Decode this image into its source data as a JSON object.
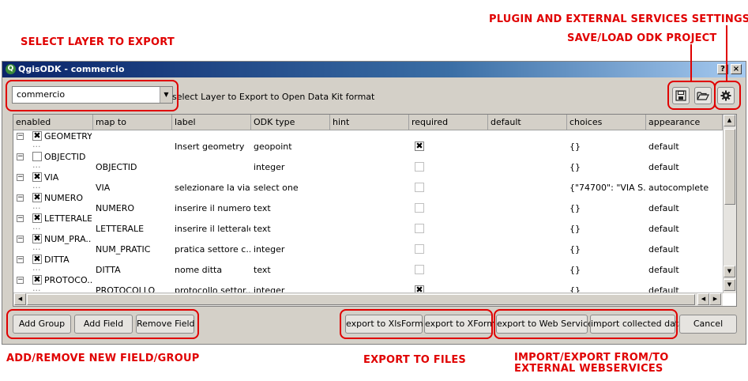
{
  "annotations": {
    "plugin_settings": "PLUGIN AND EXTERNAL SERVICES SETTINGS",
    "select_layer": "SELECT LAYER TO EXPORT",
    "save_load": "SAVE/LOAD ODK PROJECT",
    "add_remove": "ADD/REMOVE NEW FIELD/GROUP",
    "export_files": "EXPORT TO FILES",
    "import_export_line1": "IMPORT/EXPORT FROM/TO",
    "import_export_line2": "EXTERNAL WEBSERVICES"
  },
  "window": {
    "title": "QgisODK - commercio",
    "app_icon": "Q",
    "help_label": "?",
    "close_label": "×"
  },
  "layer": {
    "selected": "commercio",
    "hint": "select Layer to Export to Open Data Kit format"
  },
  "icons": {
    "save": "save-icon",
    "open": "folder-open-icon",
    "settings": "gear-icon"
  },
  "table": {
    "columns": [
      "enabled",
      "map to",
      "label",
      "ODK type",
      "hint",
      "required",
      "default",
      "choices",
      "appearance"
    ],
    "rows": [
      {
        "kind": "group",
        "enabled": true,
        "name": "GEOMETRY"
      },
      {
        "kind": "field",
        "map_to": "",
        "label": "Insert geometry",
        "odk_type": "geopoint",
        "hint": "",
        "required": true,
        "required_disabled": false,
        "default": "",
        "choices": "{}",
        "appearance": "default"
      },
      {
        "kind": "group",
        "enabled": false,
        "name": "OBJECTID"
      },
      {
        "kind": "field",
        "map_to": "OBJECTID",
        "label": "",
        "odk_type": "integer",
        "hint": "",
        "required": false,
        "required_disabled": true,
        "default": "",
        "choices": "{}",
        "appearance": "default"
      },
      {
        "kind": "group",
        "enabled": true,
        "name": "VIA"
      },
      {
        "kind": "field",
        "map_to": "VIA",
        "label": "selezionare la via",
        "odk_type": "select one",
        "hint": "",
        "required": false,
        "required_disabled": true,
        "default": "",
        "choices": "{\"74700\": \"VIA S...",
        "appearance": "autocomplete"
      },
      {
        "kind": "group",
        "enabled": true,
        "name": "NUMERO"
      },
      {
        "kind": "field",
        "map_to": "NUMERO",
        "label": "inserire il numero ...",
        "odk_type": "text",
        "hint": "",
        "required": false,
        "required_disabled": true,
        "default": "",
        "choices": "{}",
        "appearance": "default"
      },
      {
        "kind": "group",
        "enabled": true,
        "name": "LETTERALE"
      },
      {
        "kind": "field",
        "map_to": "LETTERALE",
        "label": "inserire il letterale",
        "odk_type": "text",
        "hint": "",
        "required": false,
        "required_disabled": true,
        "default": "",
        "choices": "{}",
        "appearance": "default"
      },
      {
        "kind": "group",
        "enabled": true,
        "name": "NUM_PRA..."
      },
      {
        "kind": "field",
        "map_to": "NUM_PRATIC",
        "label": "pratica settore c...",
        "odk_type": "integer",
        "hint": "",
        "required": false,
        "required_disabled": true,
        "default": "",
        "choices": "{}",
        "appearance": "default"
      },
      {
        "kind": "group",
        "enabled": true,
        "name": "DITTA"
      },
      {
        "kind": "field",
        "map_to": "DITTA",
        "label": "nome ditta",
        "odk_type": "text",
        "hint": "",
        "required": false,
        "required_disabled": true,
        "default": "",
        "choices": "{}",
        "appearance": "default"
      },
      {
        "kind": "group",
        "enabled": true,
        "name": "PROTOCO..."
      },
      {
        "kind": "field",
        "map_to": "PROTOCOLLO",
        "label": "protocollo settor...",
        "odk_type": "integer",
        "hint": "",
        "required": true,
        "required_disabled": false,
        "default": "",
        "choices": "{}",
        "appearance": "default"
      }
    ]
  },
  "buttons": {
    "add_group": "Add Group",
    "add_field": "Add Field",
    "remove_field": "Remove Field",
    "export_xls": "export to XlsForm",
    "export_xform": "export to XForm",
    "export_web": "export to Web Service",
    "import_data": "import collected data",
    "cancel": "Cancel"
  }
}
